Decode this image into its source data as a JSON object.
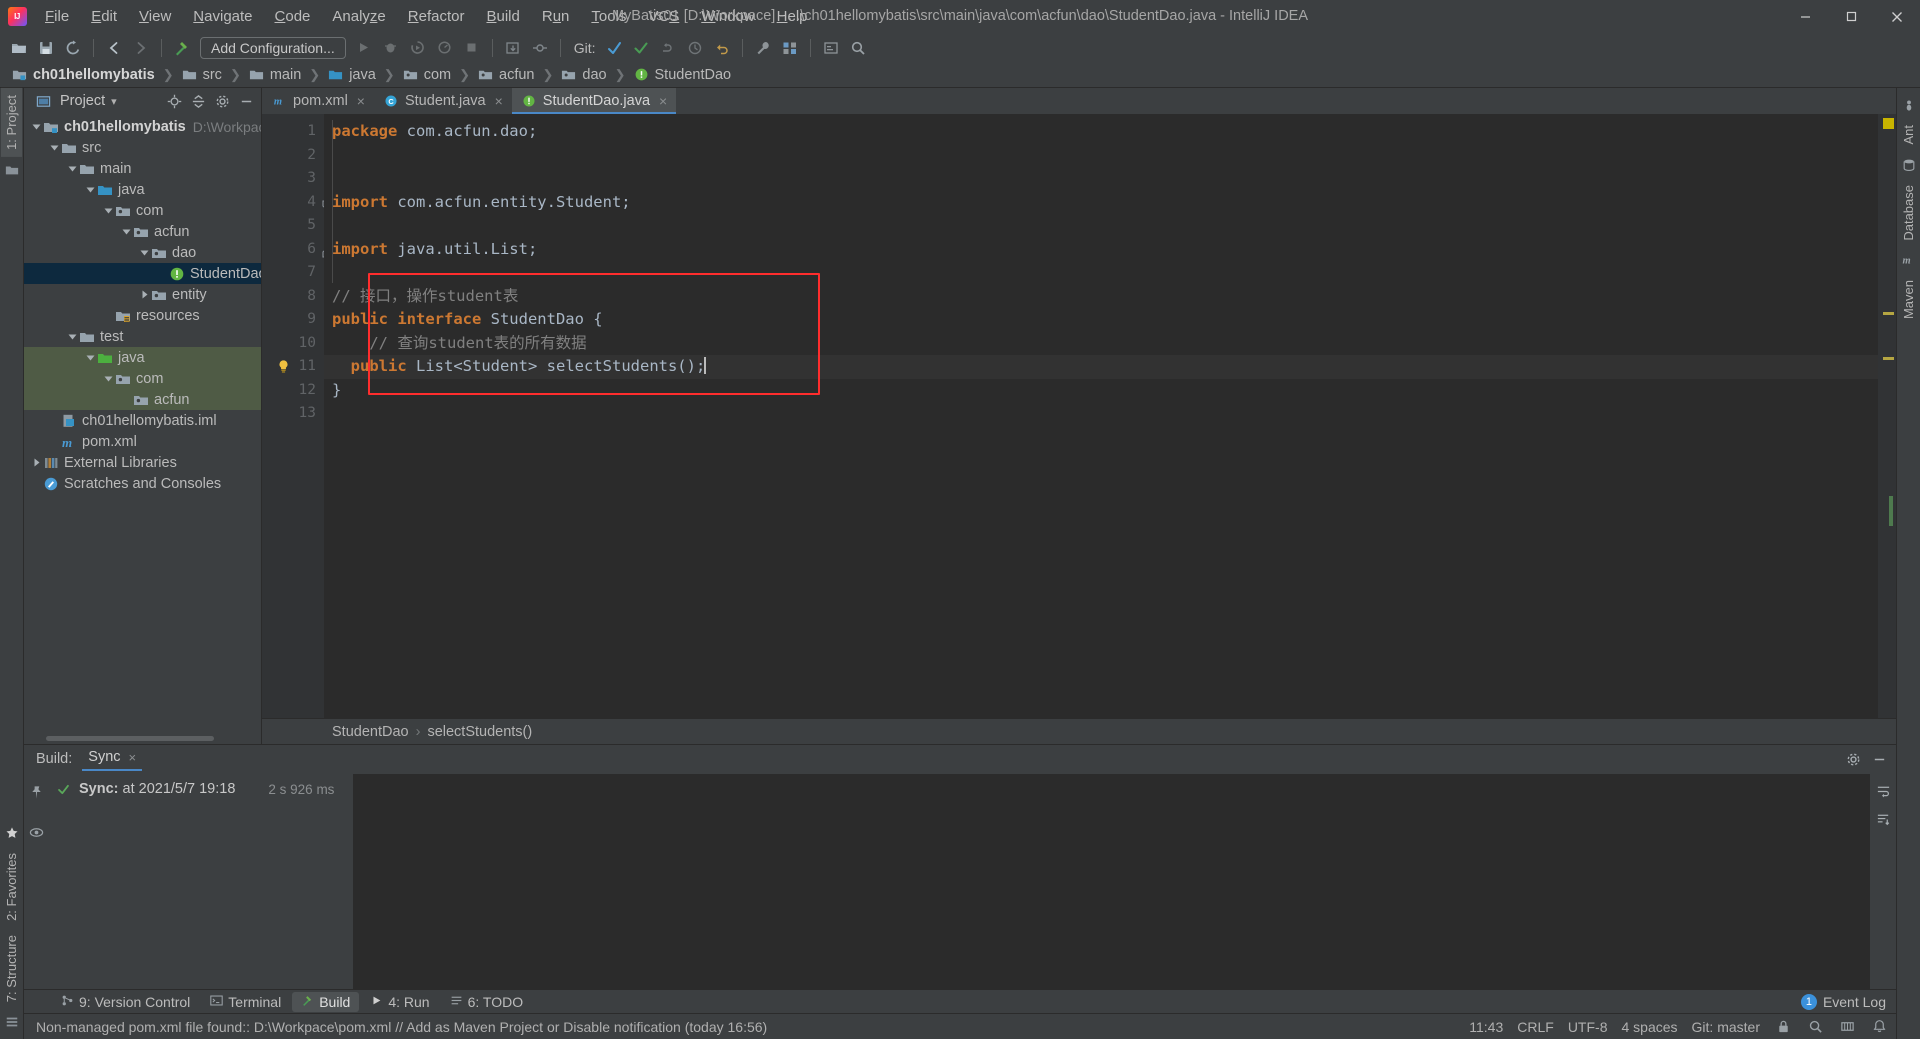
{
  "window": {
    "title": "MyBatis01 [D:\\Workpace] - ...\\ch01hellomybatis\\src\\main\\java\\com\\acfun\\dao\\StudentDao.java - IntelliJ IDEA",
    "minimize_label": "Minimize",
    "maximize_label": "Maximize",
    "close_label": "Close"
  },
  "menu": {
    "items": [
      {
        "label": "File"
      },
      {
        "label": "Edit"
      },
      {
        "label": "View"
      },
      {
        "label": "Navigate"
      },
      {
        "label": "Code"
      },
      {
        "label": "Analyze"
      },
      {
        "label": "Refactor"
      },
      {
        "label": "Build"
      },
      {
        "label": "Run"
      },
      {
        "label": "Tools"
      },
      {
        "label": "VCS"
      },
      {
        "label": "Window"
      },
      {
        "label": "Help"
      }
    ]
  },
  "toolbar": {
    "run_config": "Add Configuration...",
    "git_label": "Git:",
    "icons": [
      "open-folder-icon",
      "save-all-icon",
      "sync-icon",
      "back-arrow-icon",
      "forward-arrow-icon",
      "build-hammer-icon",
      "run-icon",
      "debug-icon",
      "run-coverage-icon",
      "profile-icon",
      "stop-icon",
      "update-project-icon",
      "commit-icon",
      "git-update-icon",
      "git-commit-check-icon",
      "git-push-icon",
      "git-history-icon",
      "git-revert-icon",
      "settings-wrench-icon",
      "project-structure-icon",
      "select-in-icon",
      "search-everywhere-icon"
    ]
  },
  "breadcrumb": {
    "items": [
      {
        "label": "ch01hellomybatis",
        "icon": "module-folder-icon",
        "bold": true
      },
      {
        "label": "src",
        "icon": "folder-icon",
        "bold": false
      },
      {
        "label": "main",
        "icon": "folder-icon",
        "bold": false
      },
      {
        "label": "java",
        "icon": "source-folder-icon",
        "bold": false
      },
      {
        "label": "com",
        "icon": "package-icon",
        "bold": false
      },
      {
        "label": "acfun",
        "icon": "package-icon",
        "bold": false
      },
      {
        "label": "dao",
        "icon": "package-icon",
        "bold": false
      },
      {
        "label": "StudentDao",
        "icon": "interface-icon",
        "bold": false
      }
    ],
    "separator": "›"
  },
  "left_strip": {
    "tabs": [
      {
        "label": "1: Project",
        "active": true
      }
    ],
    "bottom_tabs": [
      {
        "label": "2: Favorites"
      },
      {
        "label": "7: Structure"
      }
    ]
  },
  "right_strip": {
    "tabs": [
      {
        "label": "Ant"
      },
      {
        "label": "Database"
      },
      {
        "label": "Maven"
      }
    ]
  },
  "project_panel": {
    "title": "Project",
    "dropdown_caret": "▾",
    "header_icons": [
      "locate-target-icon",
      "collapse-all-icon",
      "settings-gear-icon",
      "hide-icon"
    ],
    "tree": [
      {
        "indent": 0,
        "arrow": "down",
        "icon": "module-folder-icon",
        "label": "ch01hellomybatis",
        "bold": true,
        "path": "D:\\Workpace\\c",
        "state": "normal"
      },
      {
        "indent": 1,
        "arrow": "down",
        "icon": "folder-icon",
        "label": "src",
        "bold": false,
        "path": "",
        "state": "normal"
      },
      {
        "indent": 2,
        "arrow": "down",
        "icon": "folder-icon",
        "label": "main",
        "bold": false,
        "path": "",
        "state": "normal"
      },
      {
        "indent": 3,
        "arrow": "down",
        "icon": "source-folder-icon",
        "label": "java",
        "bold": false,
        "path": "",
        "state": "normal"
      },
      {
        "indent": 4,
        "arrow": "down",
        "icon": "package-icon",
        "label": "com",
        "bold": false,
        "path": "",
        "state": "normal"
      },
      {
        "indent": 5,
        "arrow": "down",
        "icon": "package-icon",
        "label": "acfun",
        "bold": false,
        "path": "",
        "state": "normal"
      },
      {
        "indent": 6,
        "arrow": "down",
        "icon": "package-icon",
        "label": "dao",
        "bold": false,
        "path": "",
        "state": "normal"
      },
      {
        "indent": 7,
        "arrow": "none",
        "icon": "interface-icon",
        "label": "StudentDao",
        "bold": false,
        "path": "",
        "state": "selected"
      },
      {
        "indent": 6,
        "arrow": "right",
        "icon": "package-icon",
        "label": "entity",
        "bold": false,
        "path": "",
        "state": "normal"
      },
      {
        "indent": 4,
        "arrow": "none",
        "icon": "resources-folder-icon",
        "label": "resources",
        "bold": false,
        "path": "",
        "state": "normal"
      },
      {
        "indent": 2,
        "arrow": "down",
        "icon": "folder-icon",
        "label": "test",
        "bold": false,
        "path": "",
        "state": "normal"
      },
      {
        "indent": 3,
        "arrow": "down",
        "icon": "test-source-folder-icon",
        "label": "java",
        "bold": false,
        "path": "",
        "state": "green"
      },
      {
        "indent": 4,
        "arrow": "down",
        "icon": "package-icon",
        "label": "com",
        "bold": false,
        "path": "",
        "state": "green"
      },
      {
        "indent": 5,
        "arrow": "none",
        "icon": "package-icon",
        "label": "acfun",
        "bold": false,
        "path": "",
        "state": "green"
      },
      {
        "indent": 1,
        "arrow": "none",
        "icon": "iml-file-icon",
        "label": "ch01hellomybatis.iml",
        "bold": false,
        "path": "",
        "state": "normal"
      },
      {
        "indent": 1,
        "arrow": "none",
        "icon": "maven-xml-icon",
        "label": "pom.xml",
        "bold": false,
        "path": "",
        "state": "normal"
      },
      {
        "indent": 0,
        "arrow": "right",
        "icon": "libraries-icon",
        "label": "External Libraries",
        "bold": false,
        "path": "",
        "state": "normal"
      },
      {
        "indent": 0,
        "arrow": "none",
        "icon": "scratches-icon",
        "label": "Scratches and Consoles",
        "bold": false,
        "path": "",
        "state": "normal"
      }
    ]
  },
  "editor": {
    "tabs": [
      {
        "label": "pom.xml",
        "icon": "maven-xml-icon",
        "active": false,
        "close": "×"
      },
      {
        "label": "Student.java",
        "icon": "class-icon",
        "active": false,
        "close": "×"
      },
      {
        "label": "StudentDao.java",
        "icon": "interface-icon",
        "active": true,
        "close": "×"
      }
    ],
    "lines": [
      {
        "num": "1",
        "tokens": [
          {
            "t": "package ",
            "c": "kw"
          },
          {
            "t": "com.acfun.dao;",
            "c": "ident"
          }
        ],
        "fold": "",
        "bulb": false
      },
      {
        "num": "2",
        "tokens": [],
        "fold": "",
        "bulb": false
      },
      {
        "num": "3",
        "tokens": [],
        "fold": "",
        "bulb": false
      },
      {
        "num": "4",
        "tokens": [
          {
            "t": "import ",
            "c": "kw"
          },
          {
            "t": "com.acfun.entity.Student;",
            "c": "ident"
          }
        ],
        "fold": "collapse-top",
        "bulb": false
      },
      {
        "num": "5",
        "tokens": [],
        "fold": "",
        "bulb": false
      },
      {
        "num": "6",
        "tokens": [
          {
            "t": "import ",
            "c": "kw"
          },
          {
            "t": "java.util.List;",
            "c": "ident"
          }
        ],
        "fold": "collapse-bottom",
        "bulb": false
      },
      {
        "num": "7",
        "tokens": [],
        "fold": "",
        "bulb": false
      },
      {
        "num": "8",
        "tokens": [
          {
            "t": "// 接口，操作student表",
            "c": "cmt"
          }
        ],
        "fold": "",
        "bulb": false
      },
      {
        "num": "9",
        "tokens": [
          {
            "t": "public interface ",
            "c": "kw"
          },
          {
            "t": "StudentDao ",
            "c": "typ"
          },
          {
            "t": "{",
            "c": "punc"
          }
        ],
        "fold": "",
        "bulb": false
      },
      {
        "num": "10",
        "tokens": [
          {
            "t": "    // 查询student表的所有数据",
            "c": "cmt"
          }
        ],
        "fold": "",
        "bulb": false
      },
      {
        "num": "11",
        "tokens": [
          {
            "t": "  public ",
            "c": "kw"
          },
          {
            "t": "List<",
            "c": "typ"
          },
          {
            "t": "Student",
            "c": "typ"
          },
          {
            "t": "> selectStudents();",
            "c": "ident"
          }
        ],
        "fold": "",
        "bulb": true,
        "caret": true,
        "current": true
      },
      {
        "num": "12",
        "tokens": [
          {
            "t": "}",
            "c": "punc"
          }
        ],
        "fold": "",
        "bulb": false
      },
      {
        "num": "13",
        "tokens": [],
        "fold": "",
        "bulb": false
      }
    ],
    "bottom_breadcrumb": [
      "StudentDao",
      "selectStudents()"
    ],
    "bottom_breadcrumb_sep": "›",
    "annotation_box_color": "#ff2d2d"
  },
  "build_panel": {
    "label": "Build:",
    "tab": "Sync",
    "tab_close": "×",
    "header_icons": [
      "settings-gear-icon",
      "hide-panel-icon"
    ],
    "side_icons": [
      "pin-icon",
      "eye-icon"
    ],
    "right_icons": [
      "soft-wrap-icon",
      "sort-icon"
    ],
    "tree": [
      {
        "status": "ok",
        "text_prefix": "Sync:",
        "text": " at 2021/5/7 19:18",
        "duration": "2 s 926 ms"
      }
    ]
  },
  "bottom_tabs": {
    "items": [
      {
        "label": "9: Version Control",
        "icon": "version-control-icon",
        "active": false
      },
      {
        "label": "Terminal",
        "icon": "terminal-icon",
        "active": false
      },
      {
        "label": "Build",
        "icon": "build-hammer-icon",
        "active": true
      },
      {
        "label": "4: Run",
        "icon": "run-icon",
        "active": false
      },
      {
        "label": "6: TODO",
        "icon": "todo-icon",
        "active": false
      }
    ],
    "event_log": {
      "count": "1",
      "label": "Event Log"
    }
  },
  "statusbar": {
    "message": "Non-managed pom.xml file found:: D:\\Workpace\\pom.xml // Add as Maven Project or Disable notification (today 16:56)",
    "caret_position": "11:43",
    "line_separator": "CRLF",
    "encoding": "UTF-8",
    "indent": "4 spaces",
    "git_branch": "Git: master",
    "right_icons": [
      "lock-icon",
      "inspection-icon",
      "memory-icon",
      "notifications-icon"
    ]
  },
  "colors": {
    "accent": "#4a88c7",
    "selection": "#0d293e",
    "test_source_highlight": "#4f5b45",
    "keyword": "#cc7832",
    "comment": "#808080",
    "identifier": "#a9b7c6",
    "annotation_red": "#ff2d2d",
    "panel_bg": "#3c3f41",
    "editor_bg": "#2b2b2b",
    "gutter_bg": "#313335"
  }
}
